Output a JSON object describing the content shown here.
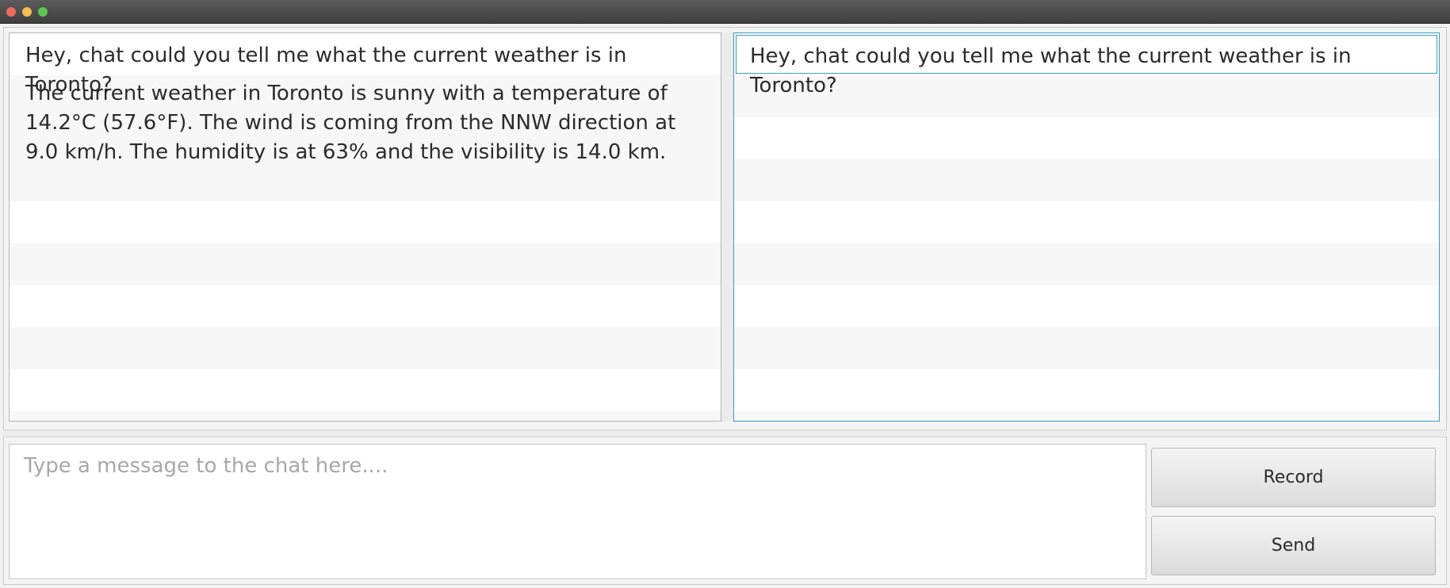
{
  "window": {
    "controls": [
      "close",
      "minimize",
      "maximize"
    ]
  },
  "chat_history": {
    "messages": [
      "Hey, chat could you tell me what the current weather is in Toronto?",
      "The current weather in Toronto is sunny with a temperature of 14.2°C (57.6°F). The wind is coming from the NNW direction at 9.0 km/h. The humidity is at 63% and the visibility is 14.0 km."
    ]
  },
  "saved_prompts": {
    "items": [
      "Hey, chat could you tell me what the current weather is in Toronto?"
    ]
  },
  "composer": {
    "placeholder": "Type a message to the chat here....",
    "value": ""
  },
  "buttons": {
    "record_label": "Record",
    "send_label": "Send"
  },
  "colors": {
    "selection_border": "#3c9ab8",
    "row_alt": "#f7f7f7"
  }
}
